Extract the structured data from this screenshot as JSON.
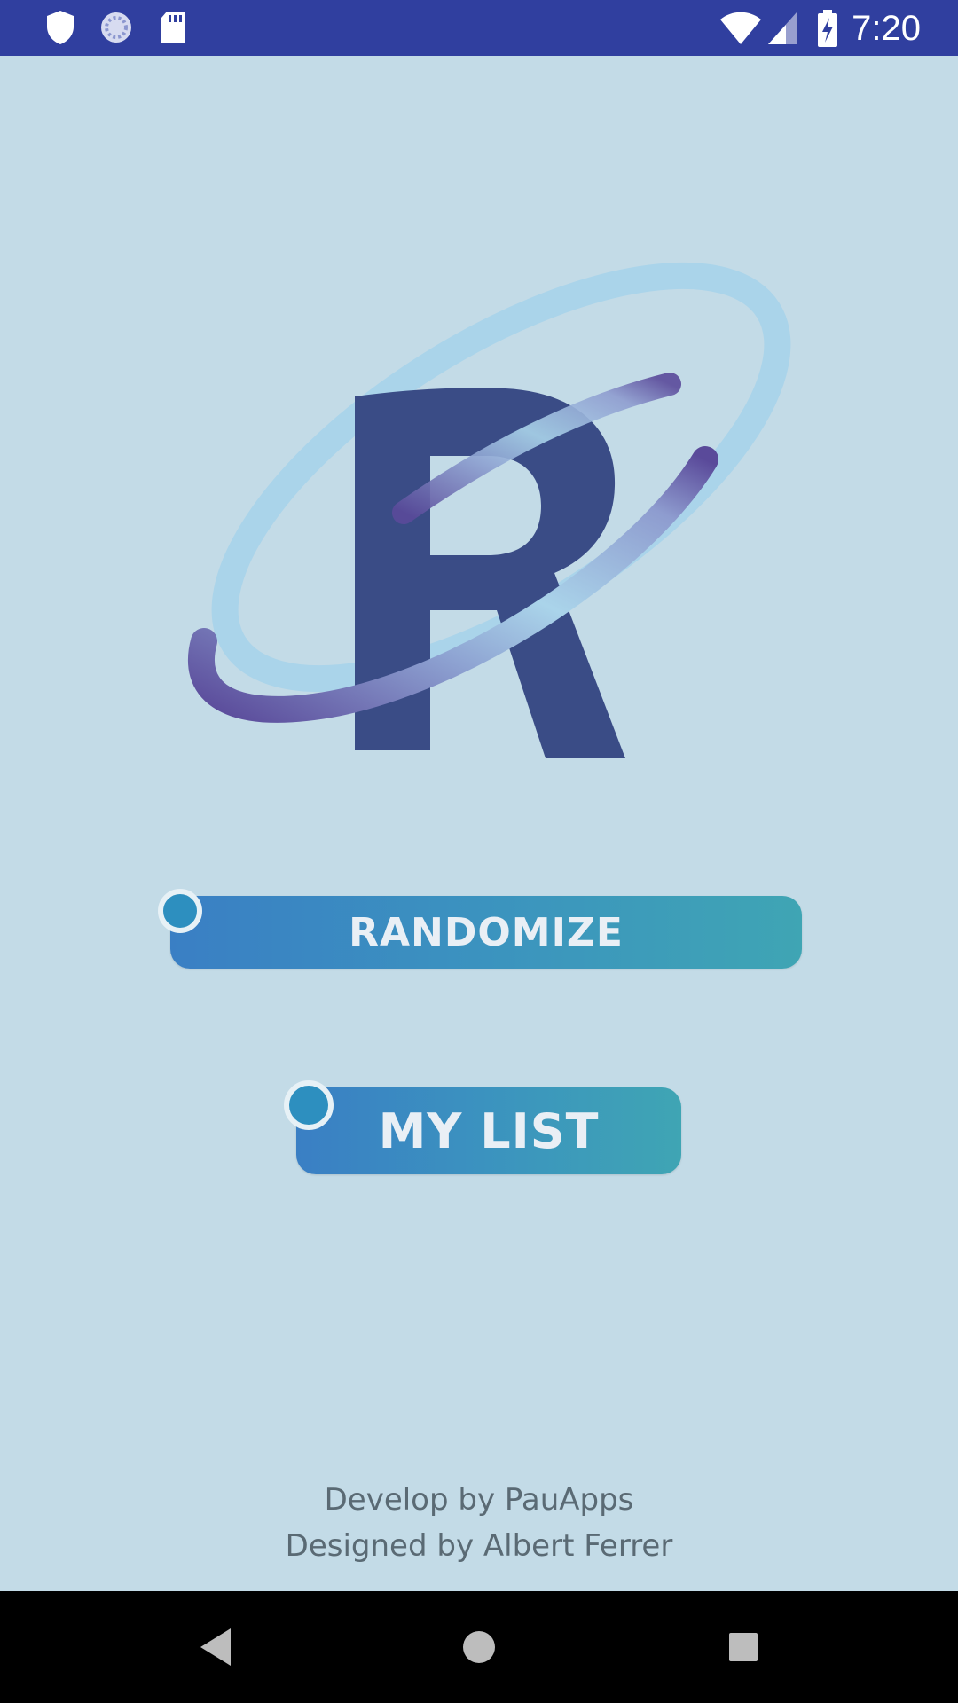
{
  "status_bar": {
    "time": "7:20",
    "left_icons": [
      "shield-icon",
      "sync-icon",
      "sd-card-icon"
    ],
    "right_icons": [
      "wifi-icon",
      "signal-icon",
      "battery-charging-icon"
    ],
    "background": "#303f9f"
  },
  "logo": {
    "letter": "R",
    "letter_color": "#3a4c86",
    "ring_colors": [
      "#5a4a9a",
      "#aad4ea"
    ]
  },
  "buttons": {
    "randomize": "RANDOMIZE",
    "my_list": "MY LIST"
  },
  "credits": {
    "line1": "Develop by PauApps",
    "line2": "Designed by Albert Ferrer"
  },
  "nav_bar": {
    "icons": [
      "back-icon",
      "home-icon",
      "recents-icon"
    ]
  },
  "colors": {
    "background": "#c3dbe7",
    "button_gradient_start": "#3a7fc4",
    "button_gradient_end": "#3fa5b4"
  }
}
